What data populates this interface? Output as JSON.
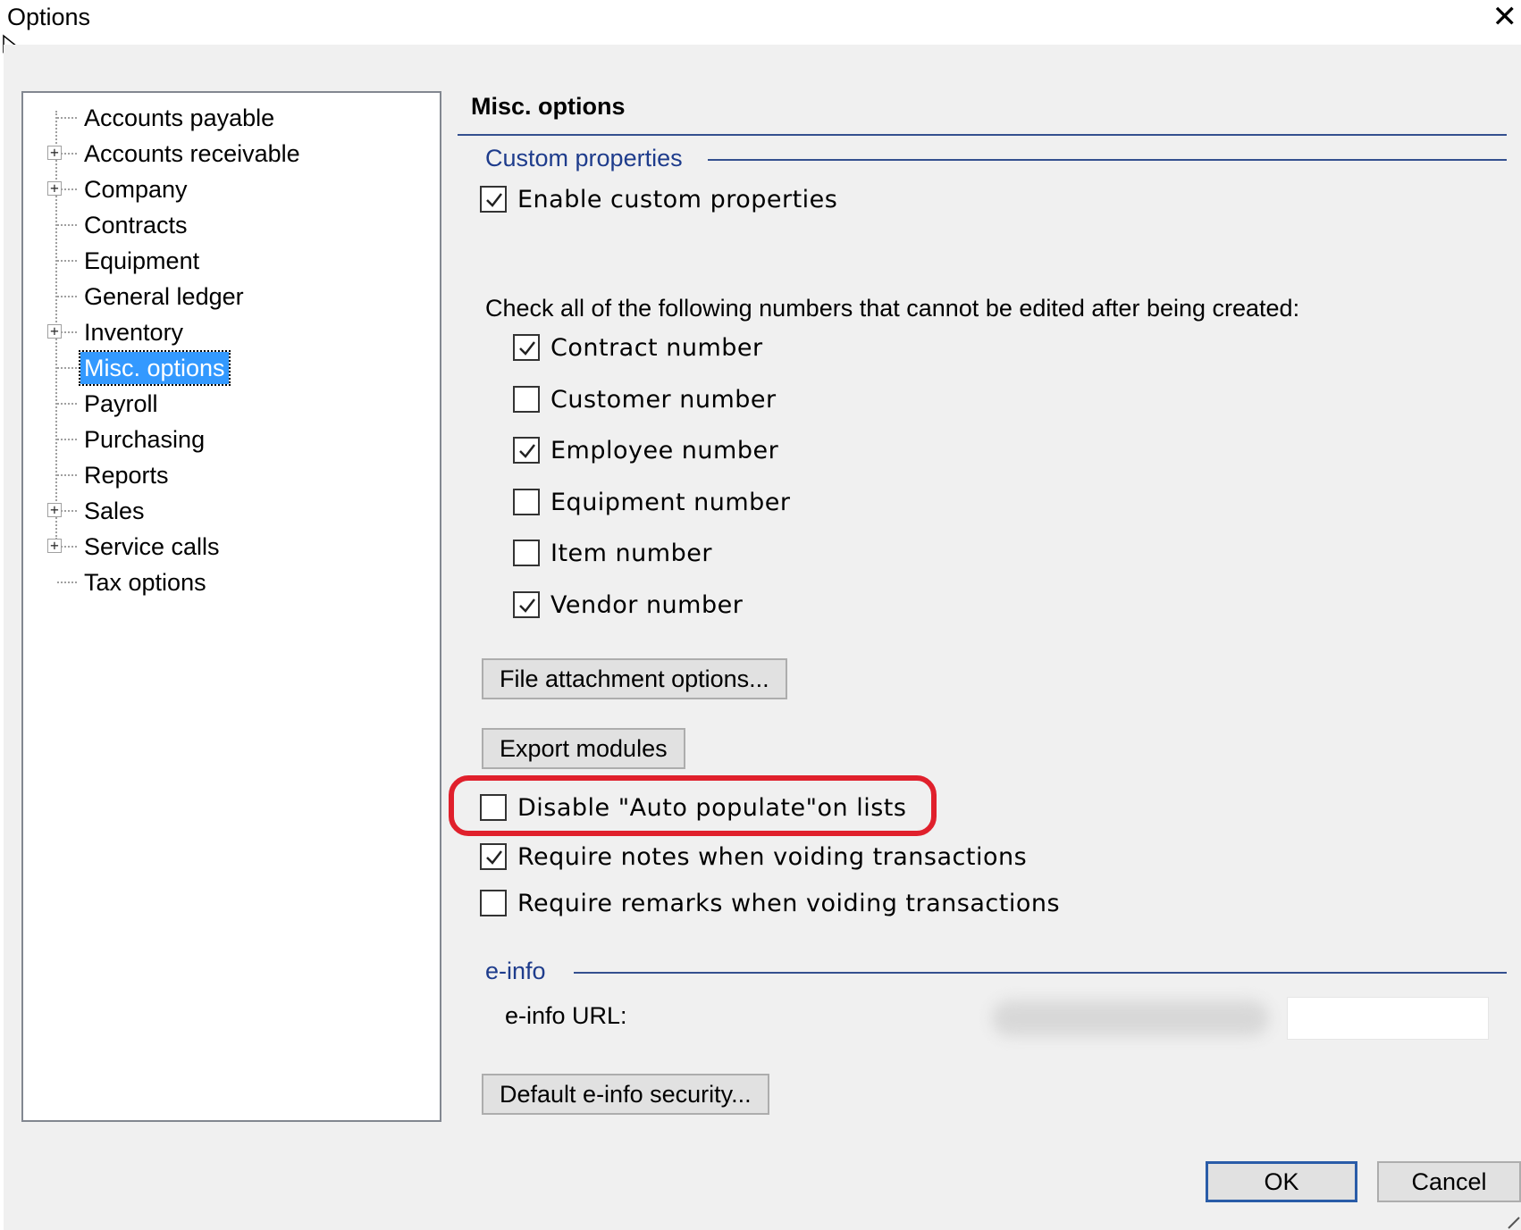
{
  "window": {
    "title": "Options",
    "close_glyph": "✕"
  },
  "tree": {
    "items": [
      {
        "label": "Accounts payable",
        "expandable": false,
        "selected": false
      },
      {
        "label": "Accounts receivable",
        "expandable": true,
        "selected": false
      },
      {
        "label": "Company",
        "expandable": true,
        "selected": false
      },
      {
        "label": "Contracts",
        "expandable": false,
        "selected": false
      },
      {
        "label": "Equipment",
        "expandable": false,
        "selected": false
      },
      {
        "label": "General ledger",
        "expandable": false,
        "selected": false
      },
      {
        "label": "Inventory",
        "expandable": true,
        "selected": false
      },
      {
        "label": "Misc. options",
        "expandable": false,
        "selected": true
      },
      {
        "label": "Payroll",
        "expandable": false,
        "selected": false
      },
      {
        "label": "Purchasing",
        "expandable": false,
        "selected": false
      },
      {
        "label": "Reports",
        "expandable": false,
        "selected": false
      },
      {
        "label": "Sales",
        "expandable": true,
        "selected": false
      },
      {
        "label": "Service calls",
        "expandable": true,
        "selected": false
      },
      {
        "label": "Tax options",
        "expandable": false,
        "selected": false
      }
    ],
    "expander_glyph": "+"
  },
  "panel": {
    "heading": "Misc. options",
    "custom_properties": {
      "group_title": "Custom properties",
      "enable_label": "Enable custom properties",
      "enable_checked": true
    },
    "numbers": {
      "prompt": "Check all of the following numbers that cannot be edited after being created:",
      "items": [
        {
          "label": "Contract number",
          "checked": true
        },
        {
          "label": "Customer number",
          "checked": false
        },
        {
          "label": "Employee number",
          "checked": true
        },
        {
          "label": "Equipment number",
          "checked": false
        },
        {
          "label": "Item number",
          "checked": false
        },
        {
          "label": "Vendor number",
          "checked": true
        }
      ]
    },
    "file_attachment_button": "File attachment options...",
    "export_modules_button": "Export modules",
    "options": [
      {
        "label": "Disable \"Auto populate\"on lists",
        "checked": false
      },
      {
        "label": "Require notes when voiding transactions",
        "checked": true
      },
      {
        "label": "Require remarks when voiding transactions",
        "checked": false
      }
    ],
    "einfo": {
      "group_title": "e-info",
      "url_label": "e-info URL:",
      "security_button": "Default e-info security..."
    }
  },
  "footer": {
    "ok_label": "OK",
    "cancel_label": "Cancel"
  },
  "colors": {
    "group_title": "#1e3c8c",
    "selection": "#3399ff",
    "highlight_oval": "#e0202c",
    "default_button_border": "#2a5ca8"
  }
}
